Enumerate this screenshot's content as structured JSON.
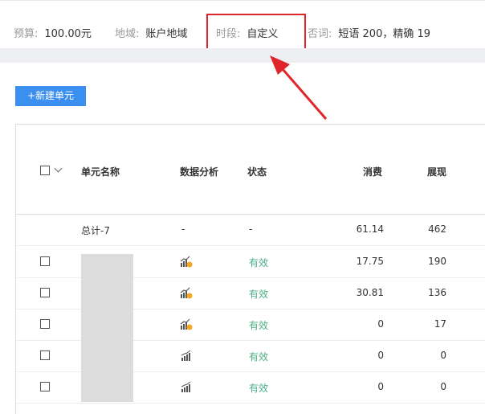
{
  "header": {
    "budget_label": "预算:",
    "budget_value": "100.00元",
    "region_label": "地域:",
    "region_value": "账户地域",
    "period_label": "时段:",
    "period_value": "自定义",
    "negative_label": "否词:",
    "negative_value": "短语 200，精确 19"
  },
  "toolbar": {
    "new_unit_label": "+新建单元"
  },
  "table": {
    "columns": {
      "name": "单元名称",
      "analysis": "数据分析",
      "status": "状态",
      "cost": "消费",
      "impressions": "展现"
    },
    "total": {
      "name": "总计-7",
      "analysis": "-",
      "status": "-",
      "cost": "61.14",
      "impressions": "462"
    },
    "rows": [
      {
        "status": "有效",
        "cost": "17.75",
        "impressions": "190",
        "analysis_icon": "trend-up-warning-icon"
      },
      {
        "status": "有效",
        "cost": "30.81",
        "impressions": "136",
        "analysis_icon": "trend-up-warning-icon"
      },
      {
        "status": "有效",
        "cost": "0",
        "impressions": "17",
        "analysis_icon": "trend-up-warning-icon"
      },
      {
        "status": "有效",
        "cost": "0",
        "impressions": "0",
        "analysis_icon": "bar-trend-icon"
      },
      {
        "status": "有效",
        "cost": "0",
        "impressions": "0",
        "analysis_icon": "bar-trend-icon"
      }
    ]
  },
  "colors": {
    "accent": "#3b8ff0",
    "valid_status": "#4cae86",
    "annotation_red": "#e0262b"
  },
  "annotation": {
    "icon": "red-arrow-icon"
  }
}
